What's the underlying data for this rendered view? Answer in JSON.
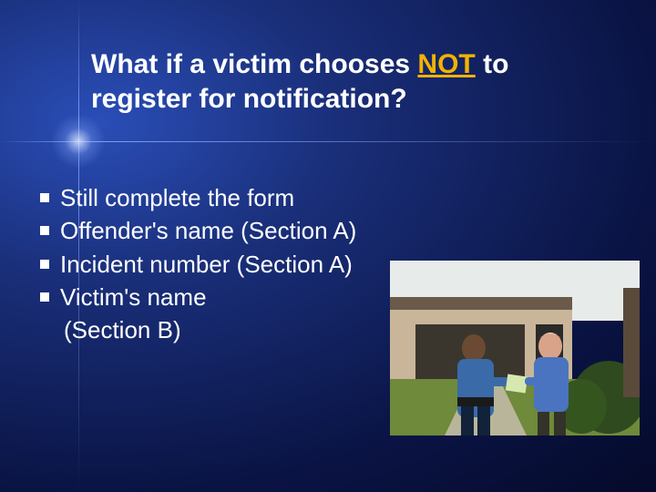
{
  "title": {
    "pre": "What if a victim chooses ",
    "em": "NOT",
    "post": " to register for notification?"
  },
  "bullets": [
    {
      "text": "Still complete the form"
    },
    {
      "text": "Offender's name (Section A)"
    },
    {
      "text": "Incident number (Section A)"
    },
    {
      "text": "Victim's name"
    }
  ],
  "continuation": "(Section B)",
  "photo_alt": "Police officer speaking with a civilian outside a house"
}
